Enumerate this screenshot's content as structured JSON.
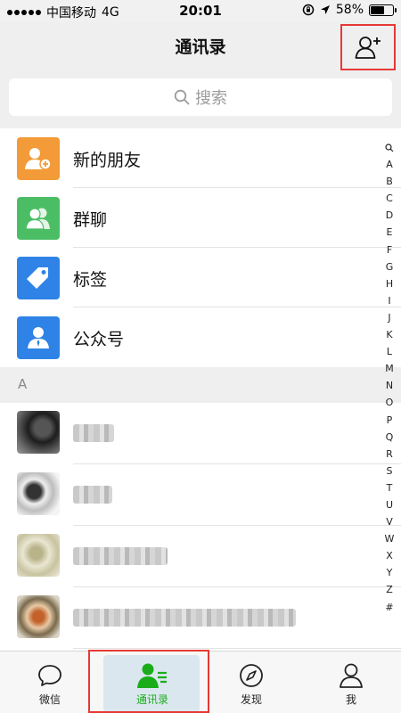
{
  "status_bar": {
    "carrier": "中国移动",
    "network": "4G",
    "time": "20:01",
    "battery_percent": "58%",
    "battery_level": 0.58
  },
  "header": {
    "title": "通讯录",
    "add_contact_icon": "person-add-icon"
  },
  "search": {
    "placeholder": "搜索",
    "icon": "search-icon"
  },
  "fixed_entries": [
    {
      "label": "新的朋友",
      "icon": "new-friend-icon",
      "color": "#f29b38"
    },
    {
      "label": "群聊",
      "icon": "group-chat-icon",
      "color": "#4bbe65"
    },
    {
      "label": "标签",
      "icon": "tag-icon",
      "color": "#2f83e6"
    },
    {
      "label": "公众号",
      "icon": "official-account-icon",
      "color": "#2f83e6"
    }
  ],
  "section_header": "A",
  "index_letters": [
    "A",
    "B",
    "C",
    "D",
    "E",
    "F",
    "G",
    "H",
    "I",
    "J",
    "K",
    "L",
    "M",
    "N",
    "O",
    "P",
    "Q",
    "R",
    "S",
    "T",
    "U",
    "V",
    "W",
    "X",
    "Y",
    "Z",
    "#"
  ],
  "tabs": [
    {
      "label": "微信",
      "icon": "chat-bubble-icon",
      "active": false
    },
    {
      "label": "通讯录",
      "icon": "contacts-icon",
      "active": true
    },
    {
      "label": "发现",
      "icon": "compass-icon",
      "active": false
    },
    {
      "label": "我",
      "icon": "person-icon",
      "active": false
    }
  ],
  "colors": {
    "accent_green": "#1aad19",
    "highlight_red": "#e53935"
  }
}
